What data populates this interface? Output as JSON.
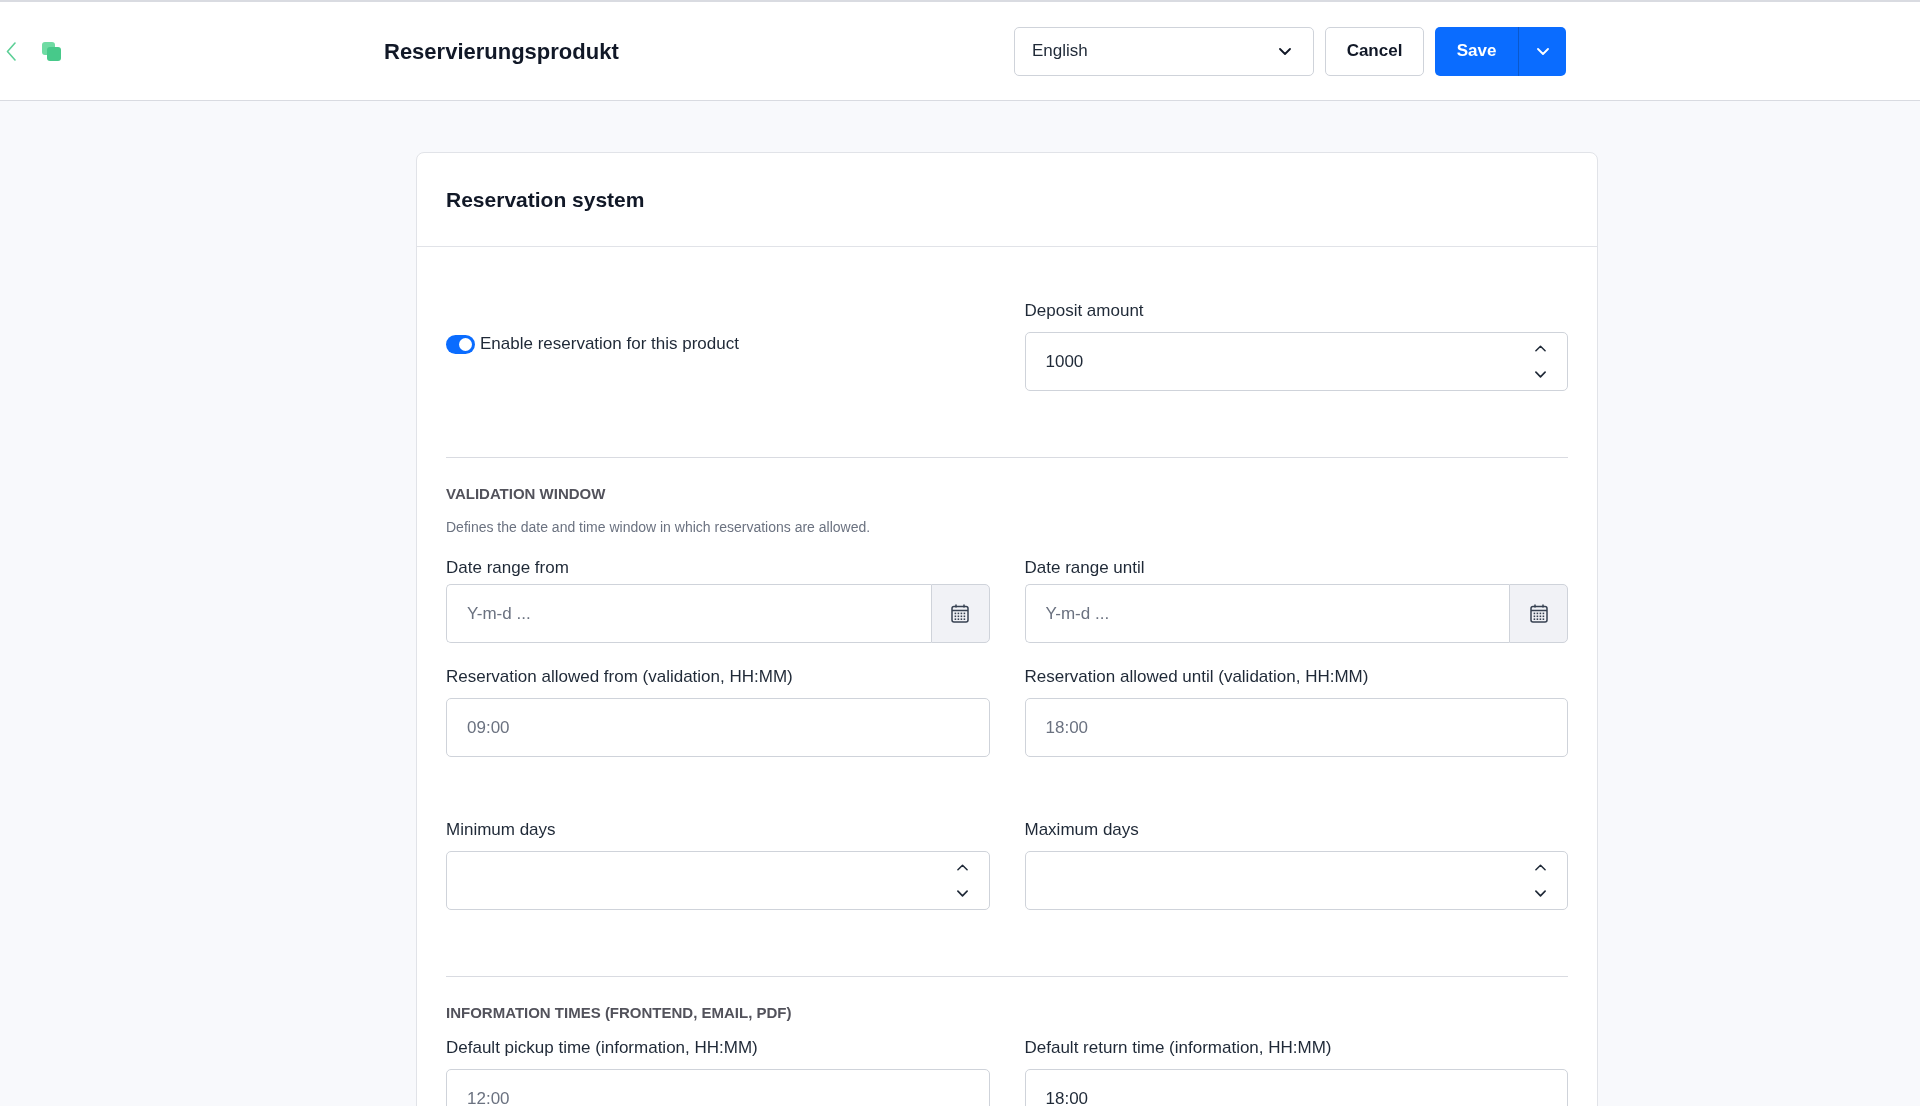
{
  "header": {
    "title": "Reservierungsprodukt",
    "language_select": {
      "value": "English"
    },
    "buttons": [
      {
        "kind": "secondary",
        "label": "Cancel"
      },
      {
        "kind": "primary_split",
        "label": "Save"
      }
    ]
  },
  "card": {
    "title": "Reservation system",
    "sections": [
      {
        "groups": [
          {
            "fields": [
              {
                "kind": "toggle",
                "label": "Enable reservation for this product",
                "on": true
              },
              {
                "kind": "number",
                "label": "Deposit amount",
                "value": "1000"
              }
            ]
          }
        ]
      },
      {
        "heading": "VALIDATION WINDOW",
        "description": "Defines the date and time window in which reservations are allowed.",
        "groups": [
          {
            "fields": [
              {
                "kind": "date",
                "label": "Date range from",
                "placeholder": "Y-m-d ..."
              },
              {
                "kind": "date",
                "label": "Date range until",
                "placeholder": "Y-m-d ..."
              },
              {
                "kind": "text",
                "label": "Reservation allowed from (validation, HH:MM)",
                "placeholder": "09:00"
              },
              {
                "kind": "text",
                "label": "Reservation allowed until (validation, HH:MM)",
                "placeholder": "18:00"
              }
            ]
          },
          {
            "fields": [
              {
                "kind": "number",
                "label": "Minimum days"
              },
              {
                "kind": "number",
                "label": "Maximum days"
              }
            ]
          }
        ]
      },
      {
        "heading": "INFORMATION TIMES (FRONTEND, EMAIL, PDF)",
        "groups": [
          {
            "fields": [
              {
                "kind": "text",
                "label": "Default pickup time (information, HH:MM)",
                "placeholder": "12:00"
              },
              {
                "kind": "text",
                "label": "Default return time (information, HH:MM)",
                "value": "18:00"
              }
            ]
          }
        ]
      }
    ]
  }
}
